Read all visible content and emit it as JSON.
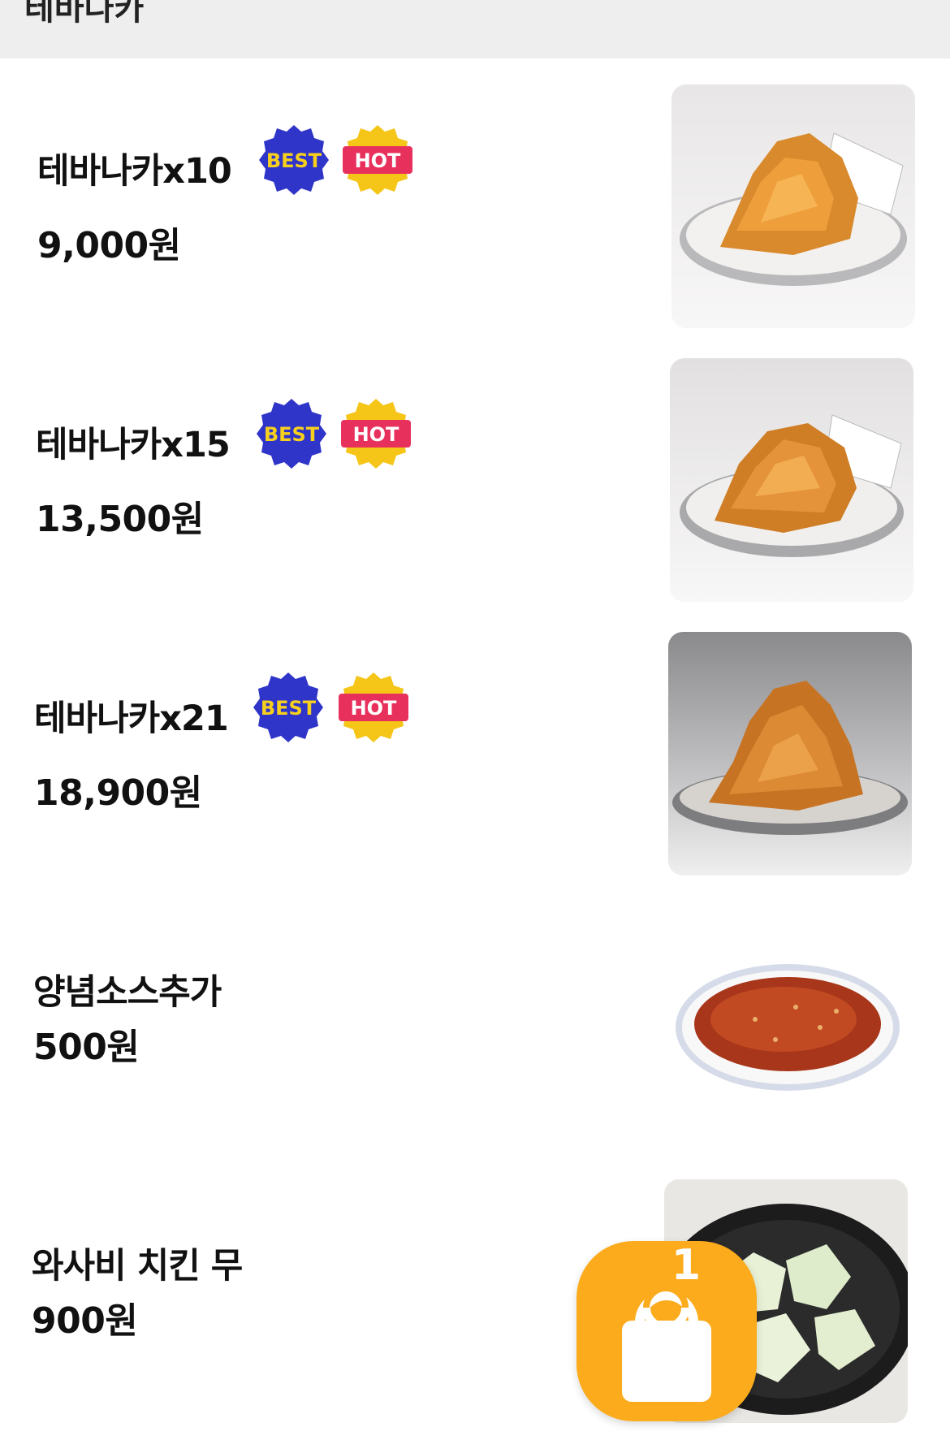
{
  "header": {
    "title": "테바나카"
  },
  "badges": {
    "best": "BEST",
    "hot": "HOT"
  },
  "items": [
    {
      "name": "테바나카x10",
      "price": "9,000원"
    },
    {
      "name": "테바나카x15",
      "price": "13,500원"
    },
    {
      "name": "테바나카x21",
      "price": "18,900원"
    },
    {
      "name": "양념소스추가",
      "price": "500원"
    },
    {
      "name": "와사비 치킨 무",
      "price": "900원"
    }
  ],
  "cart": {
    "count": "1"
  },
  "colors": {
    "accent": "#fcab1c",
    "best_badge": "#2f35c8",
    "hot_badge": "#f5c518",
    "hot_badge_inner": "#e8305c"
  }
}
